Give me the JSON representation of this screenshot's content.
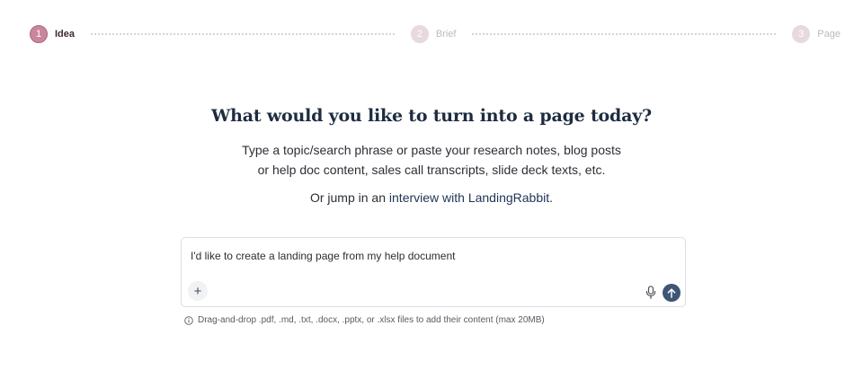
{
  "stepper": {
    "steps": [
      {
        "number": "1",
        "label": "Idea",
        "state": "active"
      },
      {
        "number": "2",
        "label": "Brief",
        "state": "inactive"
      },
      {
        "number": "3",
        "label": "Page",
        "state": "inactive"
      }
    ]
  },
  "hero": {
    "title": "What would you like to turn into a page today?",
    "description_line1": "Type a topic/search phrase or paste your research notes, blog posts",
    "description_line2": "or help doc content, sales call transcripts, slide deck texts, etc.",
    "interview_prefix": "Or jump in an ",
    "interview_link": "interview with LandingRabbit",
    "interview_suffix": "."
  },
  "composer": {
    "value": "I'd like to create a landing page from my help document",
    "attach_symbol": "+"
  },
  "hint": {
    "text": "Drag-and-drop .pdf, .md, .txt, .docx, .pptx, or .xlsx files to add their content (max 20MB)"
  },
  "colors": {
    "accent": "#c9869c",
    "send_button": "#3e5575",
    "title": "#1e2c40"
  }
}
